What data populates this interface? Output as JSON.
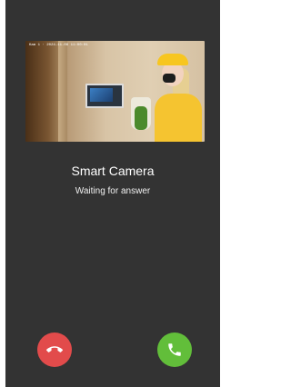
{
  "video_feed": {
    "osd_text": "Kam 1 · 2024-11-06 11:00:01"
  },
  "call": {
    "device_name": "Smart Camera",
    "status": "Waiting for answer"
  },
  "buttons": {
    "decline_icon": "phone-hangup-icon",
    "accept_icon": "phone-icon"
  },
  "colors": {
    "background": "#333333",
    "decline": "#e24b4b",
    "accept": "#62be3a"
  }
}
